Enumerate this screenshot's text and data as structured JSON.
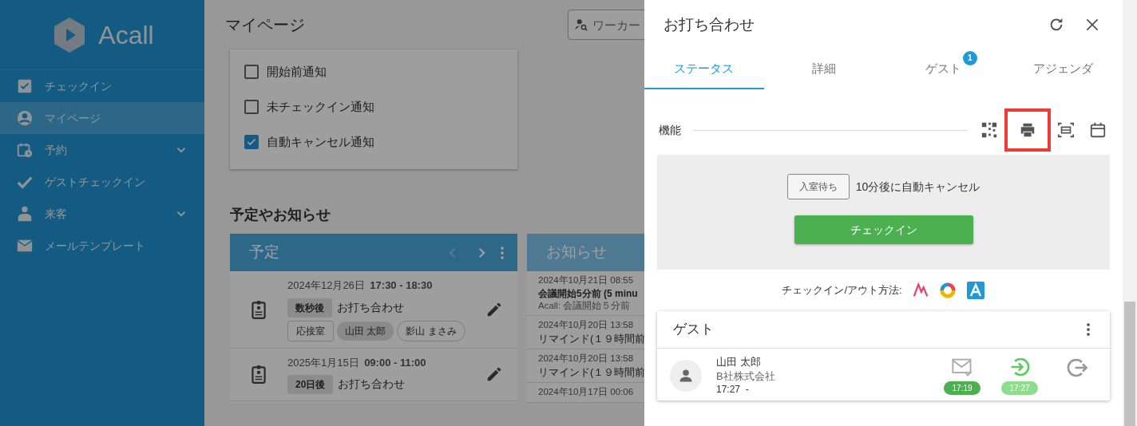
{
  "sidebar": {
    "logo": "Acall",
    "items": [
      {
        "label": "チェックイン",
        "selected": false,
        "expandable": false
      },
      {
        "label": "マイページ",
        "selected": true,
        "expandable": false
      },
      {
        "label": "予約",
        "selected": false,
        "expandable": true
      },
      {
        "label": "ゲストチェックイン",
        "selected": false,
        "expandable": false
      },
      {
        "label": "来客",
        "selected": false,
        "expandable": true
      },
      {
        "label": "メールテンプレート",
        "selected": false,
        "expandable": false
      }
    ]
  },
  "main": {
    "title": "マイページ",
    "search": {
      "placeholder": "ワーカー"
    },
    "notifications": [
      {
        "label": "開始前通知",
        "checked": false
      },
      {
        "label": "未チェックイン通知",
        "checked": false
      },
      {
        "label": "自動キャンセル通知",
        "checked": true
      }
    ],
    "section_title": "予定やお知らせ",
    "schedule": {
      "title": "予定",
      "prev": {
        "disabled": true
      },
      "next": {
        "disabled": false
      },
      "events": [
        {
          "date": "2024年12月26日",
          "time": "17:30 - 18:30",
          "relative": "数秒後",
          "title": "お打ち合わせ",
          "chips": [
            {
              "label": "応接室",
              "kind": "room"
            },
            {
              "label": "山田 太郎",
              "kind": "host"
            },
            {
              "label": "影山 まさみ",
              "kind": "guest"
            }
          ]
        },
        {
          "date": "2025年1月15日",
          "time": "09:00 - 11:00",
          "relative": "20日後",
          "title": "お打ち合わせ"
        }
      ]
    },
    "notices": {
      "title": "お知らせ",
      "items": [
        {
          "date": "2024年10月21日 08:55",
          "title": "会議開始5分前 (5 minu",
          "body": "Acall: 会議開始５分前"
        },
        {
          "date": "2024年10月20日 13:58",
          "title": "リマインド(１９時間前"
        },
        {
          "date": "2024年10月20日 13:58",
          "title": "リマインド(１９時間前"
        },
        {
          "date": "2024年10月17日 00:06"
        }
      ]
    }
  },
  "drawer": {
    "title": "お打ち合わせ",
    "tabs": [
      {
        "label": "ステータス",
        "selected": true
      },
      {
        "label": "詳細",
        "selected": false
      },
      {
        "label": "ゲスト",
        "selected": false,
        "badge": "1"
      },
      {
        "label": "アジェンダ",
        "selected": false
      }
    ],
    "features": {
      "label": "機能",
      "tools": [
        {
          "highlighted": false
        },
        {
          "highlighted": true
        },
        {
          "highlighted": false
        },
        {
          "highlighted": false
        }
      ]
    },
    "status": {
      "badge": "入室待ち",
      "note": "10分後に自動キャンセル",
      "button": "チェックイン"
    },
    "methods_label": "チェックイン/アウト方法:",
    "guests": {
      "title": "ゲスト",
      "items": [
        {
          "name": "山田 太郎",
          "company": "B社株式会社",
          "time": "17:27  -",
          "statuses": [
            {
              "kind": "mail",
              "time": "17:19",
              "color": "#4caf50"
            },
            {
              "kind": "checkin",
              "time": "17:27",
              "color": "#8fdc8f"
            },
            {
              "kind": "checkout"
            }
          ]
        }
      ]
    }
  }
}
